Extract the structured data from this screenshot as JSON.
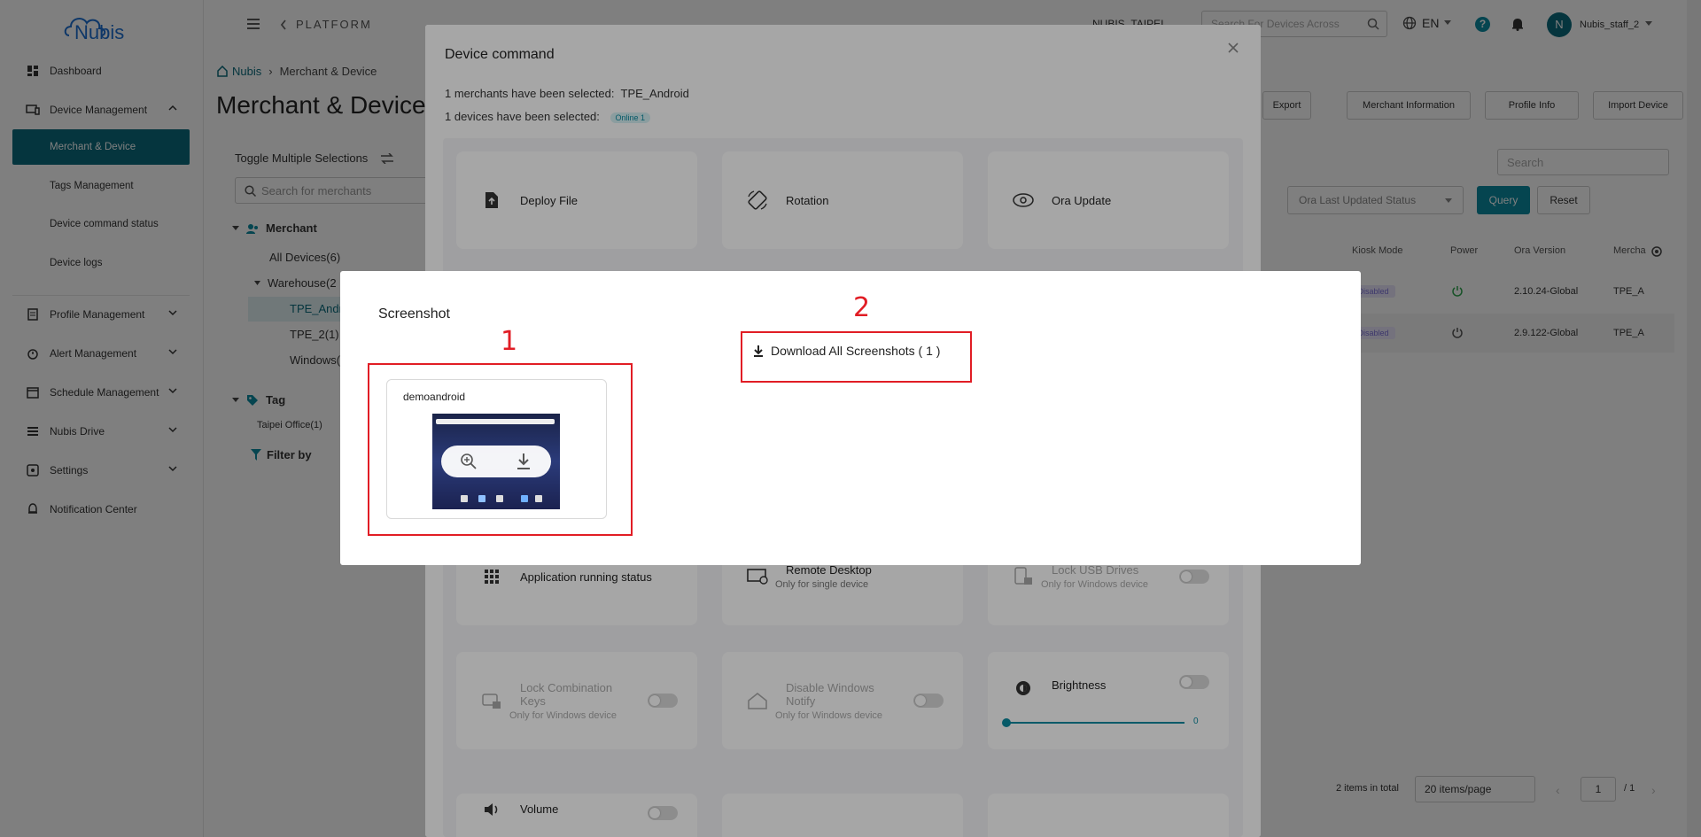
{
  "brand": {
    "logo_text": "Nubis",
    "logo_color": "#1c6fd1"
  },
  "colors": {
    "accent": "#0a6b7c",
    "annotation": "#e11d25"
  },
  "sidebar": {
    "items": [
      {
        "label": "Dashboard",
        "icon": "dashboard-icon"
      },
      {
        "label": "Device Management",
        "icon": "device-icon"
      },
      {
        "label": "Profile Management",
        "icon": "profile-icon"
      },
      {
        "label": "Alert Management",
        "icon": "alarm-icon"
      },
      {
        "label": "Schedule Management",
        "icon": "calendar-icon"
      },
      {
        "label": "Nubis Drive",
        "icon": "drive-icon"
      },
      {
        "label": "Settings",
        "icon": "settings-icon"
      },
      {
        "label": "Notification Center",
        "icon": "bell-icon"
      }
    ],
    "device_sub": [
      "Merchant & Device",
      "Tags Management",
      "Device command status",
      "Device logs"
    ]
  },
  "header": {
    "platform": "PLATFORM",
    "region": "NUBIS_TAIPEI",
    "search_placeholder": "Search For Devices Across",
    "lang": "EN",
    "help": "?",
    "avatar": "N",
    "username": "Nubis_staff_2"
  },
  "page": {
    "breadcrumb_home": "Nubis",
    "breadcrumb_current": "Merchant & Device",
    "title": "Merchant & Device",
    "toggle_label": "Toggle Multiple Selections",
    "merchant_search_placeholder": "Search for merchants",
    "tree": {
      "merchant_header": "Merchant",
      "all_devices": "All Devices(6)",
      "warehouse": "Warehouse(2",
      "tpe_android": "TPE_Andr",
      "tpe_2": "TPE_2(1)",
      "windows": "Windows(",
      "tag_header": "Tag",
      "taipei_office": "Taipei Office(1)",
      "filter_by": "Filter by"
    },
    "actions": [
      "Export",
      "Merchant Information",
      "Profile Info",
      "Import Device"
    ],
    "table_search_placeholder": "Search",
    "filter_placeholder": "Ora Last Updated Status",
    "query": "Query",
    "reset": "Reset",
    "columns": [
      "Kiosk Mode",
      "Power",
      "Ora Version",
      "Mercha"
    ],
    "rows": [
      {
        "kiosk": "Disabled",
        "version": "2.10.24-Global",
        "merchant": "TPE_A"
      },
      {
        "kiosk": "Disabled",
        "version": "2.9.122-Global",
        "merchant": "TPE_A"
      }
    ],
    "pagination": {
      "total": "2 items in total",
      "per_page": "20 items/page",
      "page": "1",
      "of": "/ 1"
    }
  },
  "device_command": {
    "title": "Device command",
    "merchants_selected_label": "1 merchants have been selected:",
    "merchants_selected_value": "TPE_Android",
    "devices_selected_label": "1 devices have been selected:",
    "online_badge": "Online 1",
    "commands": {
      "deploy": "Deploy File",
      "rotation": "Rotation",
      "ora_update": "Ora Update",
      "app_running": "Application running status",
      "remote_desktop": "Remote Desktop",
      "remote_desktop_sub": "Only for single device",
      "lock_usb": "Lock USB Drives",
      "lock_usb_sub": "Only for Windows device",
      "lock_keys": "Lock Combination Keys",
      "lock_keys_sub": "Only for Windows device",
      "disable_notify": "Disable Windows Notify",
      "disable_notify_sub": "Only for Windows device",
      "brightness": "Brightness",
      "brightness_value": "0",
      "volume": "Volume"
    }
  },
  "screenshot_dialog": {
    "title": "Screenshot",
    "device_name": "demoandroid",
    "download_all": "Download All Screenshots ( 1 )",
    "annotation_1": "1",
    "annotation_2": "2"
  }
}
